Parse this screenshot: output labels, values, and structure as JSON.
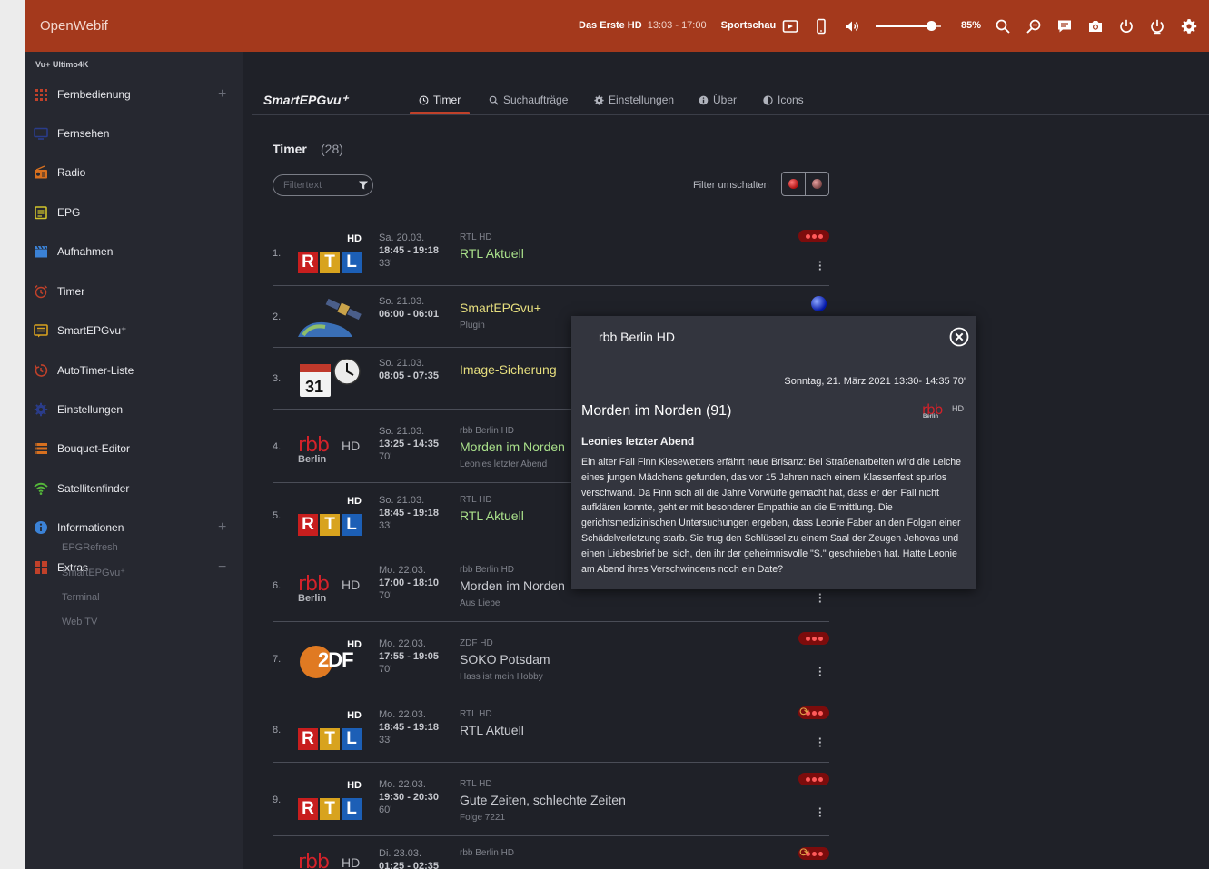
{
  "topbar": {
    "brand": "OpenWebif",
    "channel": "Das Erste HD",
    "time": "13:03 - 17:00",
    "show": "Sportschau",
    "volume_percent": 85,
    "volume_label": "85%"
  },
  "sidebar": {
    "box_name": "Vu+ Ultimo4K",
    "items": [
      {
        "label": "Fernbedienung",
        "icon": "keypad-icon",
        "color": "#c0412a",
        "expand": "+"
      },
      {
        "label": "Fernsehen",
        "icon": "tv-icon",
        "color": "#2a3c8a"
      },
      {
        "label": "Radio",
        "icon": "radio-icon",
        "color": "#d7701f"
      },
      {
        "label": "EPG",
        "icon": "epg-icon",
        "color": "#d1c42a"
      },
      {
        "label": "Aufnahmen",
        "icon": "clapper-icon",
        "color": "#3b82d6"
      },
      {
        "label": "Timer",
        "icon": "alarm-icon",
        "color": "#c0412a"
      },
      {
        "label": "SmartEPGvu⁺",
        "icon": "list-icon",
        "color": "#d7a11f"
      },
      {
        "label": "AutoTimer-Liste",
        "icon": "autotimer-icon",
        "color": "#c0412a"
      },
      {
        "label": "Einstellungen",
        "icon": "gear-icon",
        "color": "#2a3c8a"
      },
      {
        "label": "Bouquet-Editor",
        "icon": "bouquet-icon",
        "color": "#d7701f"
      },
      {
        "label": "Satellitenfinder",
        "icon": "wifi-icon",
        "color": "#55b83a"
      },
      {
        "label": "Informationen",
        "icon": "info-icon",
        "color": "#3b82d6",
        "expand": "+"
      },
      {
        "label": "Extras",
        "icon": "extras-icon",
        "color": "#c0412a",
        "expand": "−"
      }
    ],
    "subitems": [
      "EPGRefresh",
      "SmartEPGvu⁺",
      "Terminal",
      "Web TV"
    ]
  },
  "main": {
    "title": "SmartEPGvu⁺",
    "tabs": [
      {
        "label": "Timer",
        "icon": "clock-icon"
      },
      {
        "label": "Suchaufträge",
        "icon": "search-icon"
      },
      {
        "label": "Einstellungen",
        "icon": "gear-icon"
      },
      {
        "label": "Über",
        "icon": "info-icon"
      },
      {
        "label": "Icons",
        "icon": "contrast-icon"
      }
    ],
    "list_title": "Timer",
    "list_count": "(28)",
    "filter_placeholder": "Filtertext",
    "filter_toggle_label": "Filter umschalten"
  },
  "timers": [
    {
      "num": "1.",
      "logo": "rtl",
      "day": "Sa. 20.03.",
      "time": "18:45 - 19:18",
      "dur": "33'",
      "channel": "RTL HD",
      "program": "RTL Aktuell",
      "sub": "",
      "color": "green",
      "status": "led"
    },
    {
      "num": "2.",
      "logo": "satellite",
      "day": "So. 21.03.",
      "time": "06:00 - 06:01",
      "dur": "",
      "channel": "",
      "program": "SmartEPGvu+",
      "sub": "Plugin",
      "color": "yellow",
      "status": "blue"
    },
    {
      "num": "3.",
      "logo": "calendar",
      "day": "So. 21.03.",
      "time": "08:05 - 07:35",
      "dur": "",
      "channel": "",
      "program": "Image-Sicherung",
      "sub": "",
      "color": "yellow",
      "status": ""
    },
    {
      "num": "4.",
      "logo": "rbb",
      "day": "So. 21.03.",
      "time": "13:25 - 14:35",
      "dur": "70'",
      "channel": "rbb Berlin HD",
      "program": "Morden im Norden",
      "sub": "Leonies letzter Abend",
      "color": "green",
      "status": ""
    },
    {
      "num": "5.",
      "logo": "rtl",
      "day": "So. 21.03.",
      "time": "18:45 - 19:18",
      "dur": "33'",
      "channel": "RTL HD",
      "program": "RTL Aktuell",
      "sub": "",
      "color": "green",
      "status": ""
    },
    {
      "num": "6.",
      "logo": "rbb",
      "day": "Mo. 22.03.",
      "time": "17:00 - 18:10",
      "dur": "70'",
      "channel": "rbb Berlin HD",
      "program": "Morden im Norden",
      "sub": "Aus Liebe",
      "color": "plain",
      "status": "menu-only"
    },
    {
      "num": "7.",
      "logo": "zdf",
      "day": "Mo. 22.03.",
      "time": "17:55 - 19:05",
      "dur": "70'",
      "channel": "ZDF HD",
      "program": "SOKO Potsdam",
      "sub": "Hass ist mein Hobby",
      "color": "plain",
      "status": "led"
    },
    {
      "num": "8.",
      "logo": "rtl",
      "day": "Mo. 22.03.",
      "time": "18:45 - 19:18",
      "dur": "33'",
      "channel": "RTL HD",
      "program": "RTL Aktuell",
      "sub": "",
      "color": "plain",
      "status": "led-repeat"
    },
    {
      "num": "9.",
      "logo": "rtl",
      "day": "Mo. 22.03.",
      "time": "19:30 - 20:30",
      "dur": "60'",
      "channel": "RTL HD",
      "program": "Gute Zeiten, schlechte Zeiten",
      "sub": "Folge 7221",
      "color": "plain",
      "status": "led"
    },
    {
      "num": "",
      "logo": "rbb",
      "day": "Di. 23.03.",
      "time": "01:25 - 02:35",
      "dur": "",
      "channel": "rbb Berlin HD",
      "program": "",
      "sub": "",
      "color": "plain",
      "status": "led-repeat"
    }
  ],
  "logos": {
    "rtl_hd": "HD",
    "rtl_letters": [
      "R",
      "T",
      "L"
    ],
    "rtl_colors": [
      "#c81e1e",
      "#d8a31e",
      "#1c5fb6"
    ],
    "rbb_word": "rbb",
    "rbb_hd": "HD",
    "rbb_city": "Berlin",
    "zdf_text": "2DF",
    "zdf_hd": "HD",
    "calendar_day": "31"
  },
  "modal": {
    "channel": "rbb Berlin HD",
    "date": "Sonntag, 21. März 2021 13:30- 14:35  70'",
    "title": "Morden im Norden (91)",
    "subtitle": "Leonies letzter Abend",
    "description": "Ein alter Fall Finn Kiesewetters erfährt neue Brisanz: Bei Straßenarbeiten wird die Leiche eines jungen Mädchens gefunden, das vor 15 Jahren nach einem Klassenfest spurlos verschwand. Da Finn sich all die Jahre Vorwürfe gemacht hat, dass er den Fall nicht aufklären konnte, geht er mit besonderer Empathie an die Ermittlung. Die gerichtsmedizinischen Untersuchungen ergeben, dass Leonie Faber an den Folgen einer Schädelverletzung starb. Sie trug den Schlüssel zu einem Saal der Zeugen Jehovas und einen Liebesbrief bei sich, den ihr der geheimnisvolle \"S.\" geschrieben hat. Hatte Leonie am Abend ihres Verschwindens noch ein Date?",
    "logo_word": "rbb",
    "logo_hd": "HD",
    "logo_city": "Berlin"
  }
}
